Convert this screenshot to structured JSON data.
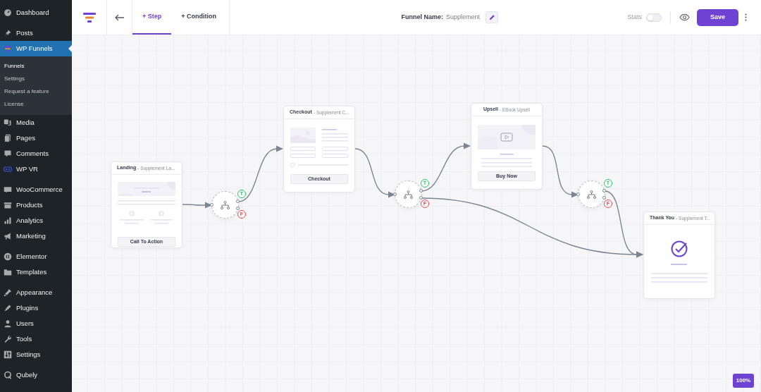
{
  "sidebar": {
    "groups": [
      [
        {
          "label": "Dashboard",
          "selected": false
        }
      ],
      [
        {
          "label": "Posts",
          "selected": false
        },
        {
          "label": "WP Funnels",
          "selected": true,
          "children": [
            {
              "label": "Funnels",
              "selected": true
            },
            {
              "label": "Settings",
              "selected": false
            },
            {
              "label": "Request a feature",
              "selected": false
            },
            {
              "label": "License",
              "selected": false
            }
          ]
        },
        {
          "label": "Media",
          "selected": false
        },
        {
          "label": "Pages",
          "selected": false
        },
        {
          "label": "Comments",
          "selected": false
        },
        {
          "label": "WP VR",
          "selected": false
        }
      ],
      [
        {
          "label": "WooCommerce",
          "selected": false
        },
        {
          "label": "Products",
          "selected": false
        },
        {
          "label": "Analytics",
          "selected": false
        },
        {
          "label": "Marketing",
          "selected": false
        }
      ],
      [
        {
          "label": "Elementor",
          "selected": false
        },
        {
          "label": "Templates",
          "selected": false
        }
      ],
      [
        {
          "label": "Appearance",
          "selected": false
        },
        {
          "label": "Plugins",
          "selected": false
        },
        {
          "label": "Users",
          "selected": false
        },
        {
          "label": "Tools",
          "selected": false
        },
        {
          "label": "Settings",
          "selected": false
        }
      ],
      [
        {
          "label": "Qubely",
          "selected": false
        }
      ]
    ]
  },
  "toolbar": {
    "tabs": [
      {
        "label": "+ Step",
        "selected": true
      },
      {
        "label": "+ Condition",
        "selected": false
      }
    ],
    "funnel_name_label": "Funnel Name:",
    "funnel_name": "Supplement",
    "stats_label": "Stats",
    "stats_on": false,
    "save": "Save"
  },
  "canvas": {
    "nodes": [
      {
        "kind": "landing",
        "title": "Landing",
        "subtitle": "- Supplement La...",
        "button": "Call To Action"
      },
      {
        "kind": "condition",
        "true_label": "T",
        "false_label": "F"
      },
      {
        "kind": "checkout",
        "title": "Checkout",
        "subtitle": "- Supplement C...",
        "button": "Checkout"
      },
      {
        "kind": "condition",
        "true_label": "T",
        "false_label": "F"
      },
      {
        "kind": "upsell",
        "title": "Upsell",
        "subtitle": "- EBook Upsell",
        "button": "Buy Now"
      },
      {
        "kind": "condition",
        "true_label": "T",
        "false_label": "F"
      },
      {
        "kind": "thankyou",
        "title": "Thank You",
        "subtitle": "- Supplement T..."
      }
    ],
    "zoom": "100%"
  }
}
